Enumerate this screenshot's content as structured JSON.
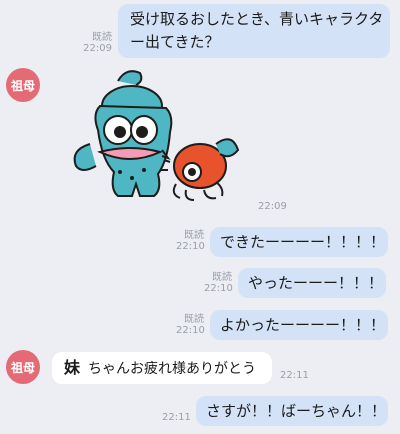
{
  "avatar_label": "祖母",
  "read_label": "既読",
  "messages": [
    {
      "text_line1": "受け取るおしたとき、青いキャラクタ",
      "text_line2": "ー出てきた？",
      "time": "22:09"
    },
    {
      "sticker_time": "22:09"
    },
    {
      "text": "できたーーーー！！！！",
      "time": "22:10"
    },
    {
      "text": "やったーーー！！！",
      "time": "22:10"
    },
    {
      "text": "よかったーーーー！！！",
      "time": "22:10"
    },
    {
      "emph": "妹",
      "text": "ちゃんお疲れ様ありがとう",
      "time": "22:11"
    },
    {
      "text": "さすが！！ばーちゃん！！",
      "time": "22:11"
    }
  ]
}
